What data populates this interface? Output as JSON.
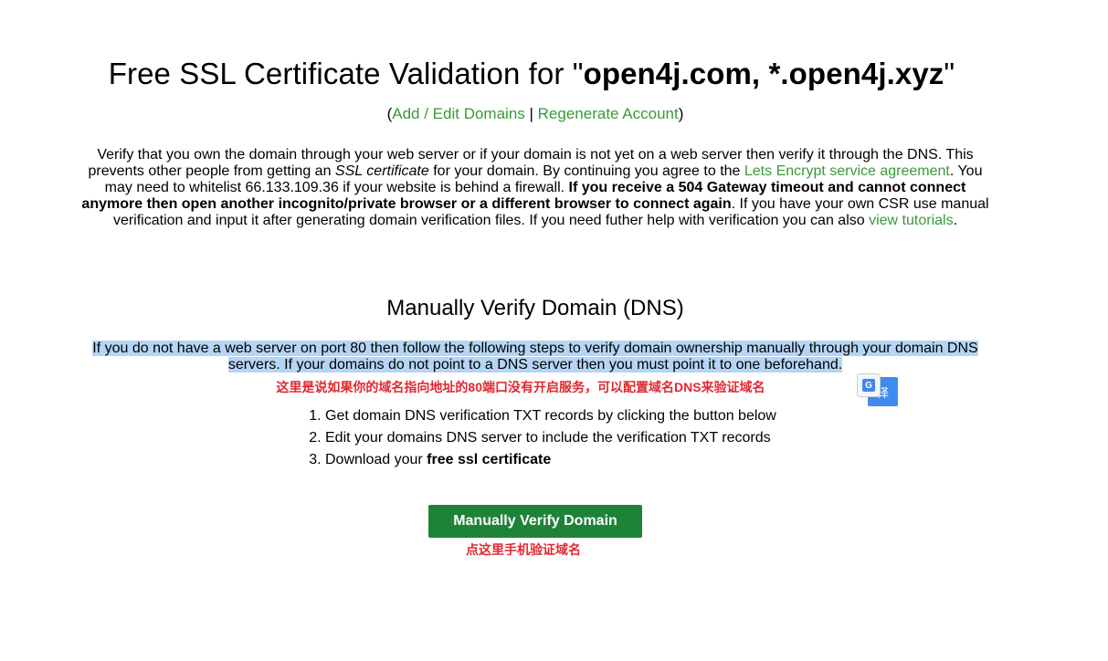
{
  "header": {
    "title_prefix": "Free SSL Certificate Validation for \"",
    "title_domains": "open4j.com, *.open4j.xyz",
    "title_suffix": "\"",
    "paren_open": "(",
    "add_edit_link": "Add / Edit Domains",
    "separator": " | ",
    "regenerate_link": "Regenerate Account",
    "paren_close": ")"
  },
  "intro": {
    "part1": "Verify that you own the domain through your web server or if your domain is not yet on a web server then verify it through the DNS. This prevents other people from getting an ",
    "ssl_italic": "SSL certificate",
    "part2": " for your domain. By continuing you agree to the ",
    "agreement_link": "Lets Encrypt service agreement",
    "part3": ". You may need to whitelist 66.133.109.36 if your website is behind a firewall. ",
    "bold_warning": "If you receive a 504 Gateway timeout and cannot connect anymore then open another incognito/private browser or a different browser to connect again",
    "part4": ". If you have your own CSR use manual verification and input it after generating domain verification files. If you need futher help with verification you can also ",
    "tutorials_link": "view tutorials",
    "part5": "."
  },
  "dns": {
    "title": "Manually Verify Domain (DNS)",
    "description": "If you do not have a web server on port 80 then follow the following steps to verify domain ownership manually through your domain DNS servers. If your domains do not point to a DNS server then you must point it to one beforehand.",
    "annotation": "这里是说如果你的域名指向地址的80端口没有开启服务，可以配置域名DNS来验证域名",
    "translate_label": "译",
    "translate_icon_text": "G",
    "steps": [
      "Get domain DNS verification TXT records by clicking the button below",
      "Edit your domains DNS server to include the verification TXT records"
    ],
    "step3_prefix": "Download your ",
    "step3_bold": "free ssl certificate",
    "button_label": "Manually Verify Domain",
    "button_annotation": "点这里手机验证域名"
  },
  "colors": {
    "link": "#3a9a36",
    "button": "#1e8339",
    "annotation": "#e0282f",
    "highlight": "#b4d5f5"
  }
}
